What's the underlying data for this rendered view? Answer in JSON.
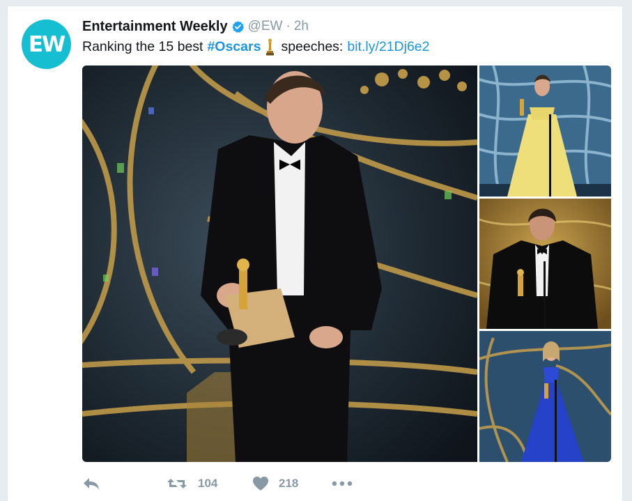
{
  "tweet": {
    "avatar_text": "EW",
    "display_name": "Entertainment Weekly",
    "handle": "@EW",
    "separator": "·",
    "time": "2h",
    "text_prefix": "Ranking the 15 best",
    "hashtag": "#Oscars",
    "text_suffix": "speeches:",
    "link": "bit.ly/21Dj6e2",
    "verified_icon": "verified-badge-icon",
    "emoji_icon": "oscar-trophy-icon"
  },
  "actions": {
    "reply_icon": "reply-icon",
    "retweet_icon": "retweet-icon",
    "retweet_count": "104",
    "like_icon": "heart-icon",
    "like_count": "218",
    "more_icon": "more-dots-icon"
  },
  "colors": {
    "brand_avatar": "#15bfd1",
    "link": "#1b95e0",
    "muted": "#8899a6",
    "text": "#14171a",
    "stage_gold": "#c8a04a"
  }
}
